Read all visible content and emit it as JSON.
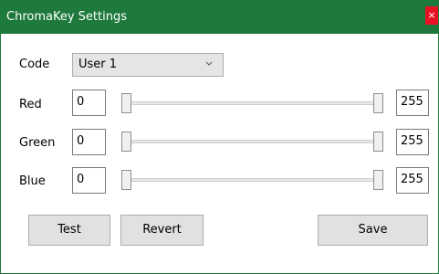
{
  "window": {
    "title": "ChromaKey Settings",
    "close_glyph": "×"
  },
  "code": {
    "label": "Code",
    "value": "User 1"
  },
  "channels": [
    {
      "label": "Red",
      "min_value": "0",
      "max_value": "255"
    },
    {
      "label": "Green",
      "min_value": "0",
      "max_value": "255"
    },
    {
      "label": "Blue",
      "min_value": "0",
      "max_value": "255"
    }
  ],
  "buttons": {
    "test": "Test",
    "revert": "Revert",
    "save": "Save"
  },
  "colors": {
    "titlebar": "#1e7a3c",
    "close": "#e81123"
  },
  "icons": {
    "dropdown": "chevron-down-icon",
    "close": "close-icon"
  }
}
